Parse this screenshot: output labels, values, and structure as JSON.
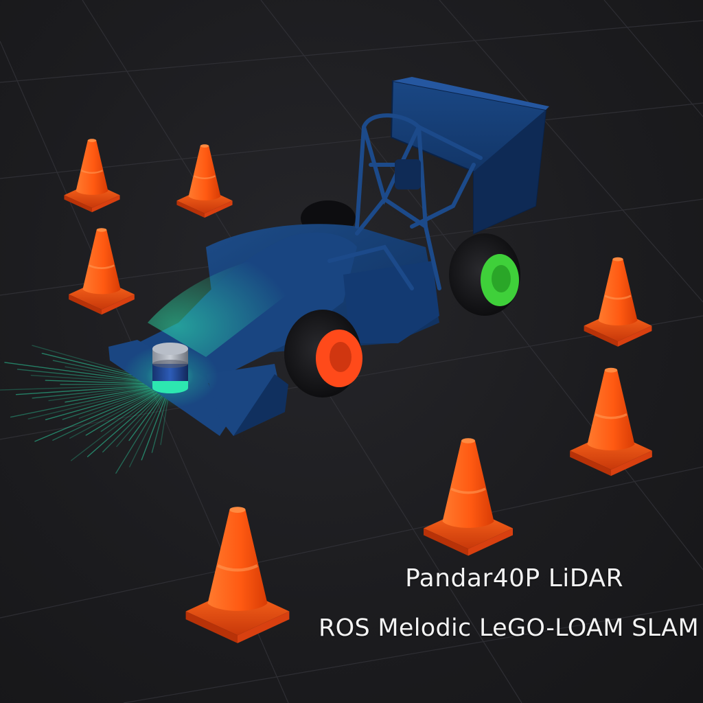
{
  "captions": {
    "line1": "Pandar40P LiDAR",
    "line2": "ROS Melodic LeGO-LOAM SLAM"
  },
  "colors": {
    "background": "#1b1b1d",
    "grid": "#3a3a3f",
    "car_body": "#143a6e",
    "cone": "#ff5a12",
    "lidar_beam": "#2ee8b0",
    "rear_wheel_hub": "#3fd03a",
    "front_wheel_hub": "#ff4a1a"
  }
}
